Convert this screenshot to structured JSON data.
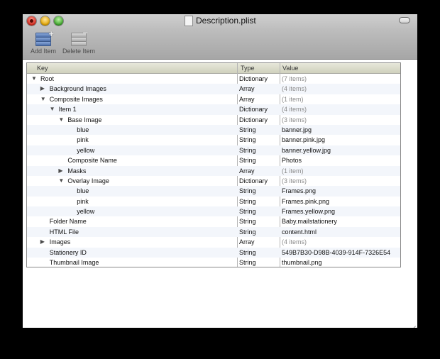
{
  "window": {
    "title": "Description.plist"
  },
  "toolbar": {
    "add_label": "Add Item",
    "delete_label": "Delete Item"
  },
  "table": {
    "columns": {
      "key": "Key",
      "type": "Type",
      "value": "Value"
    },
    "rows": [
      {
        "key": "Root",
        "indent": 0,
        "disclosure": "open",
        "type": "Dictionary",
        "value": "(7 items)",
        "muted": true
      },
      {
        "key": "Background Images",
        "indent": 1,
        "disclosure": "closed",
        "type": "Array",
        "value": "(4 items)",
        "muted": true
      },
      {
        "key": "Composite Images",
        "indent": 1,
        "disclosure": "open",
        "type": "Array",
        "value": "(1 item)",
        "muted": true
      },
      {
        "key": "Item 1",
        "indent": 2,
        "disclosure": "open",
        "type": "Dictionary",
        "value": "(4 items)",
        "muted": true
      },
      {
        "key": "Base Image",
        "indent": 3,
        "disclosure": "open",
        "type": "Dictionary",
        "value": "(3 items)",
        "muted": true
      },
      {
        "key": "blue",
        "indent": 4,
        "disclosure": "none",
        "type": "String",
        "value": "banner.jpg",
        "muted": false
      },
      {
        "key": "pink",
        "indent": 4,
        "disclosure": "none",
        "type": "String",
        "value": "banner.pink.jpg",
        "muted": false
      },
      {
        "key": "yellow",
        "indent": 4,
        "disclosure": "none",
        "type": "String",
        "value": "banner.yellow.jpg",
        "muted": false
      },
      {
        "key": "Composite Name",
        "indent": 3,
        "disclosure": "none",
        "type": "String",
        "value": "Photos",
        "muted": false
      },
      {
        "key": "Masks",
        "indent": 3,
        "disclosure": "closed",
        "type": "Array",
        "value": "(1 item)",
        "muted": true
      },
      {
        "key": "Overlay Image",
        "indent": 3,
        "disclosure": "open",
        "type": "Dictionary",
        "value": "(3 items)",
        "muted": true
      },
      {
        "key": "blue",
        "indent": 4,
        "disclosure": "none",
        "type": "String",
        "value": "Frames.png",
        "muted": false
      },
      {
        "key": "pink",
        "indent": 4,
        "disclosure": "none",
        "type": "String",
        "value": "Frames.pink.png",
        "muted": false
      },
      {
        "key": "yellow",
        "indent": 4,
        "disclosure": "none",
        "type": "String",
        "value": "Frames.yellow.png",
        "muted": false
      },
      {
        "key": "Folder Name",
        "indent": 1,
        "disclosure": "none",
        "type": "String",
        "value": "Baby.mailstationery",
        "muted": false
      },
      {
        "key": "HTML File",
        "indent": 1,
        "disclosure": "none",
        "type": "String",
        "value": "content.html",
        "muted": false
      },
      {
        "key": "Images",
        "indent": 1,
        "disclosure": "closed",
        "type": "Array",
        "value": "(4 items)",
        "muted": true
      },
      {
        "key": "Stationery ID",
        "indent": 1,
        "disclosure": "none",
        "type": "String",
        "value": "549B7B30-D98B-4039-914F-7326E54",
        "muted": false
      },
      {
        "key": "Thumbnail Image",
        "indent": 1,
        "disclosure": "none",
        "type": "String",
        "value": "thumbnail.png",
        "muted": false
      }
    ]
  }
}
